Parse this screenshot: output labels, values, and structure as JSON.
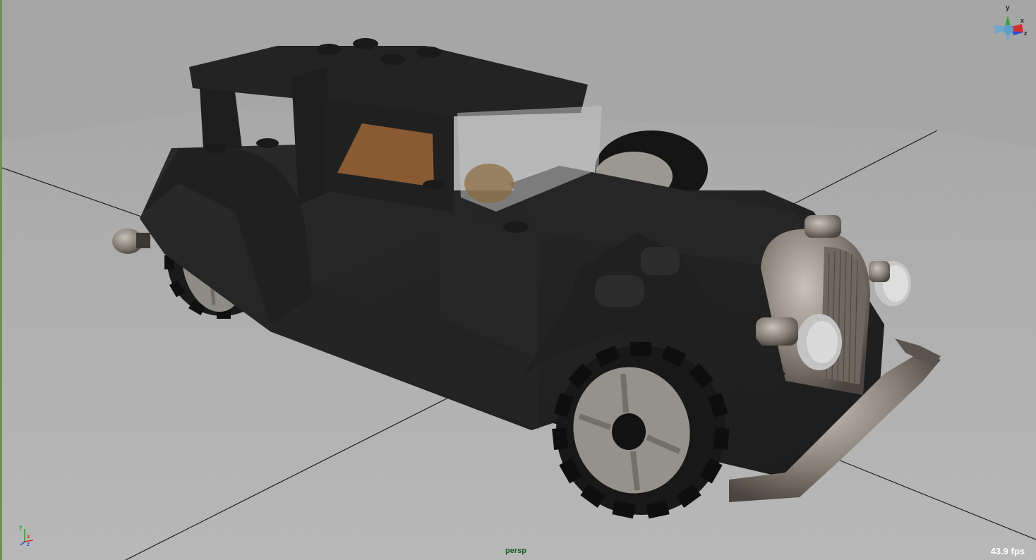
{
  "viewport": {
    "camera_name": "persp",
    "fps_text": "43.9 fps",
    "background_color": "#a6a6a6",
    "grid_color": "#b3b3b3",
    "model": "classic-car"
  },
  "view_cube": {
    "axes": [
      "y",
      "x",
      "z"
    ]
  },
  "origin_axis": {
    "axes": [
      "y",
      "x",
      "z"
    ],
    "colors": {
      "x": "#d43030",
      "y": "#2fa12f",
      "z": "#2f4fd4"
    }
  }
}
